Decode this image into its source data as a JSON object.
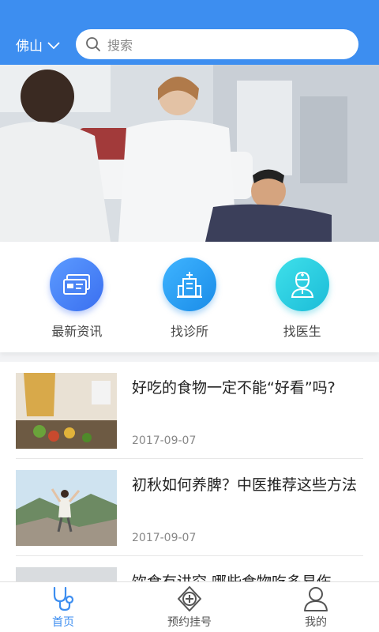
{
  "header": {
    "city": "佛山",
    "search_placeholder": "搜索"
  },
  "shortcuts": [
    {
      "label": "最新资讯",
      "icon": "news-card-icon"
    },
    {
      "label": "找诊所",
      "icon": "hospital-building-icon"
    },
    {
      "label": "找医生",
      "icon": "doctor-icon"
    }
  ],
  "articles": [
    {
      "title": "好吃的食物一定不能“好看”吗?",
      "date": "2017-09-07"
    },
    {
      "title": "初秋如何养脾？中医推荐这些方法",
      "date": "2017-09-07"
    },
    {
      "title": "饮食有讲究 哪些食物吃多易伤",
      "date": ""
    }
  ],
  "tabbar": {
    "items": [
      {
        "label": "首页",
        "icon": "stethoscope-icon",
        "active": true
      },
      {
        "label": "预约挂号",
        "icon": "appointment-plus-icon",
        "active": false
      },
      {
        "label": "我的",
        "icon": "user-profile-icon",
        "active": false
      }
    ]
  },
  "colors": {
    "primary": "#3d8ef0"
  }
}
